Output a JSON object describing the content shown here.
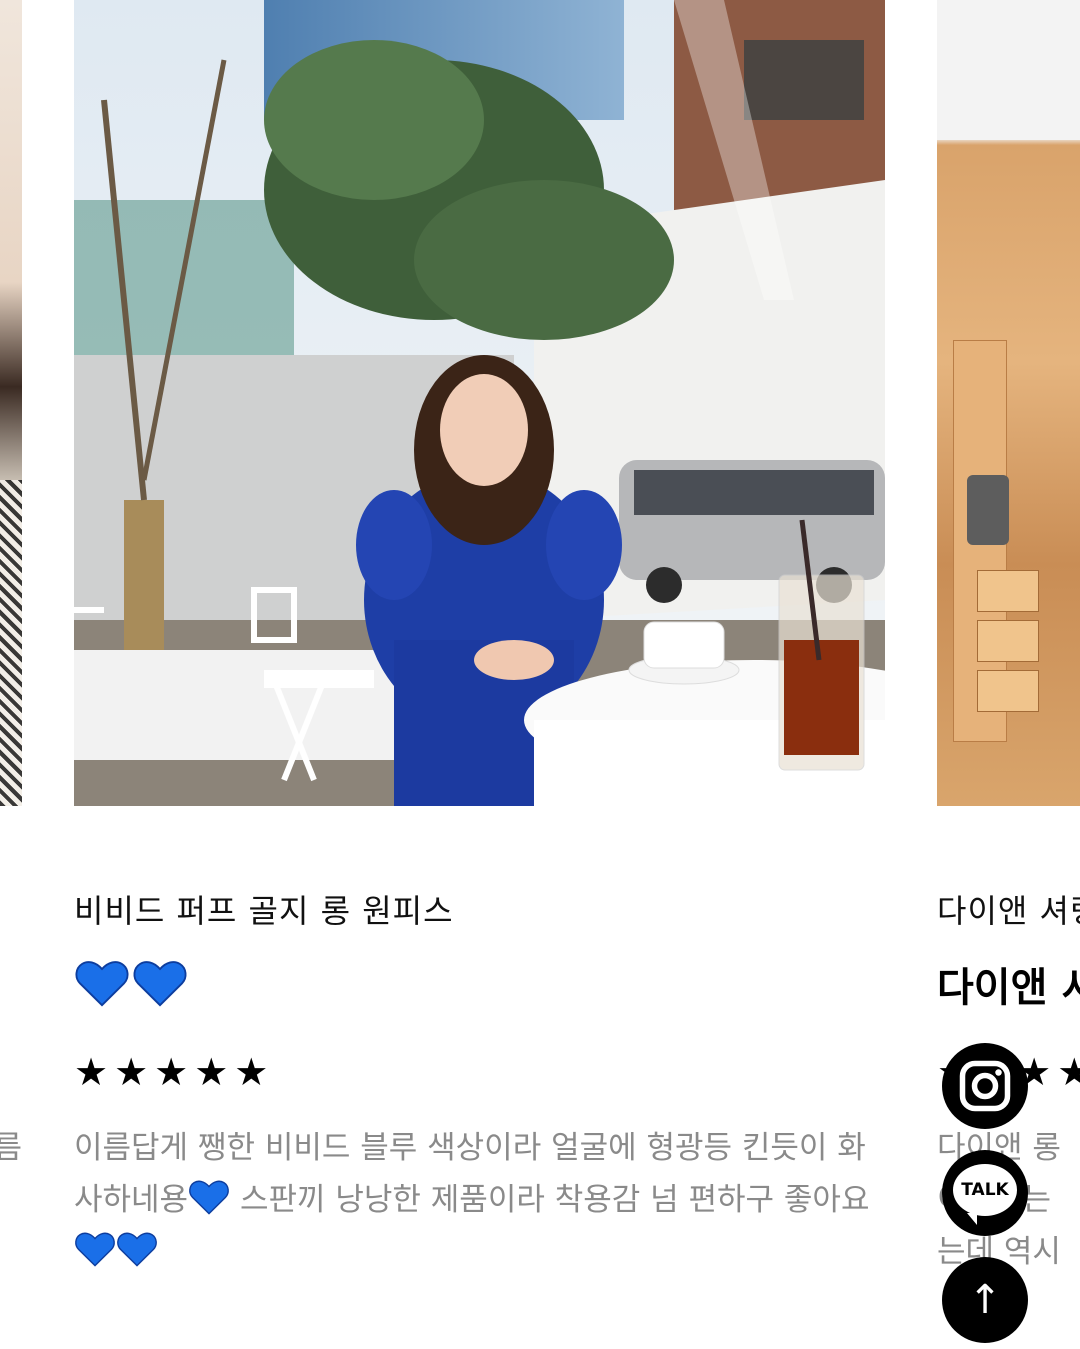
{
  "cards": {
    "left": {
      "review_fragment": "름"
    },
    "main": {
      "title": "비비드 퍼프 골지 롱 원피스",
      "emoji_title": "💙💙",
      "rating": "★★★★★",
      "review_parts": [
        "이름답게 쨍한 비비드 블루 색상이라 얼굴에 형광등 킨듯이 화사하네용",
        " 스판끼 낭낭한 제품이라 착용감 넘 편하구 좋아요"
      ]
    },
    "right": {
      "title": "다이앤 셔링",
      "subtitle": "다이앤 셔링",
      "rating": "★★★★★",
      "review": "다이앤 롱\n이었었는\n는데 역시"
    }
  },
  "floating": {
    "instagram": "instagram-icon",
    "talk_label": "TALK",
    "top_arrow": "↑"
  },
  "colors": {
    "heart": "#1a6fe8",
    "review_text": "#8a8a8a",
    "button_bg": "#000000"
  }
}
